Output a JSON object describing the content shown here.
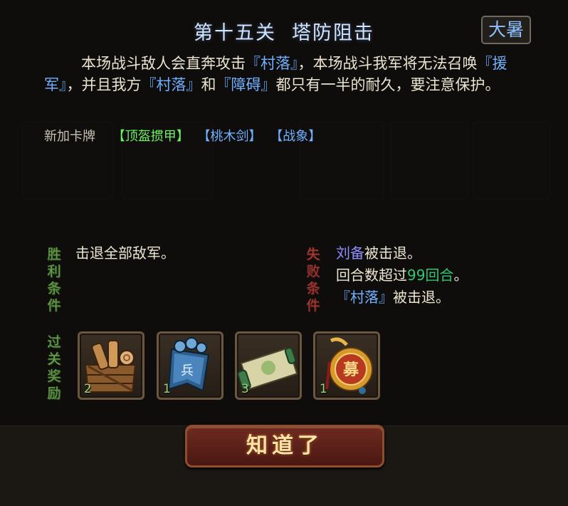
{
  "level": {
    "number": "第十五关",
    "name": "塔防阻击",
    "season_badge": "大暑"
  },
  "description": {
    "p1": "本场战斗敌人会直奔攻击",
    "village": "『村落』",
    "p2": "，本场战斗我军将无法召唤",
    "reinforce": "『援军』",
    "p3": "，并且我方",
    "village2": "『村落』",
    "p4": "和",
    "obstacle": "『障碍』",
    "p5": "都只有一半的耐久，要注意保护。"
  },
  "new_cards": {
    "label": "新加卡牌",
    "cards": [
      "【顶盔掼甲】",
      "【桃木剑】",
      "【战象】"
    ]
  },
  "victory": {
    "label": [
      "胜",
      "利",
      "条",
      "件"
    ],
    "conditions": [
      "击退全部敌军。"
    ]
  },
  "defeat": {
    "label": [
      "失",
      "败",
      "条",
      "件"
    ],
    "line1_name": "刘备",
    "line1_rest": "被击退。",
    "line2_pre": "回合数超过",
    "line2_num": "99回合",
    "line2_post": "。",
    "line3_name": "『村落』",
    "line3_rest": "被击退。"
  },
  "rewards": {
    "label": [
      "过",
      "关",
      "奖",
      "励"
    ],
    "items": [
      {
        "icon": "wood-crate-icon",
        "count": "2"
      },
      {
        "icon": "soldier-token-icon",
        "count": "1",
        "glyph": "兵"
      },
      {
        "icon": "scroll-icon",
        "count": "3"
      },
      {
        "icon": "medal-icon",
        "count": "1",
        "glyph": "募"
      }
    ]
  },
  "ok_button": "知道了",
  "colors": {
    "title": "#cfe4ff",
    "keyword_blue": "#6fb0ff",
    "card_green": "#6cf064",
    "victory_green": "#8fdc6a",
    "defeat_red": "#e6524a",
    "name_purple": "#8f8cff",
    "number_green": "#2ec872"
  }
}
